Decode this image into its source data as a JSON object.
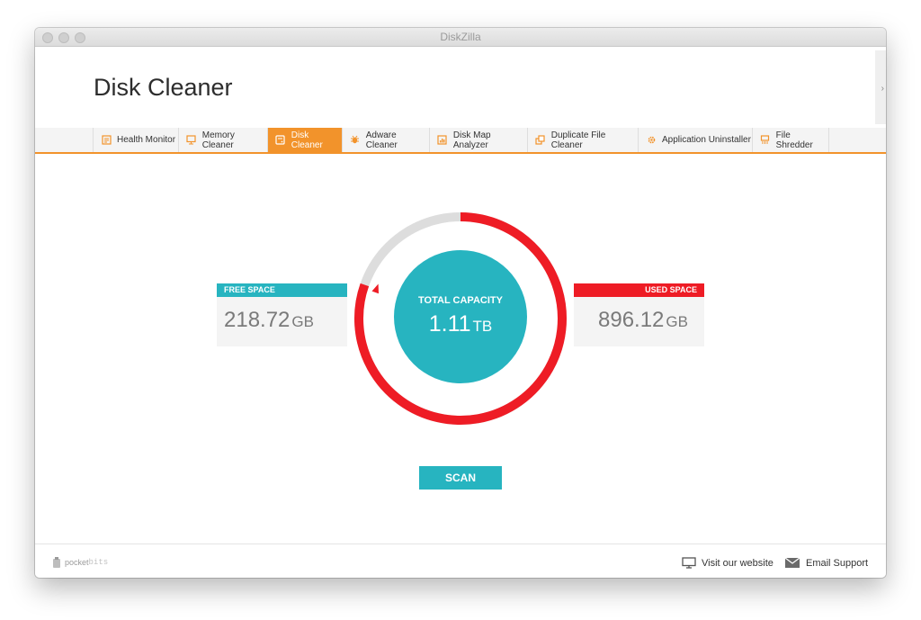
{
  "window": {
    "title": "DiskZilla"
  },
  "header": {
    "title": "Disk Cleaner"
  },
  "tabs": [
    {
      "label": "Health Monitor",
      "icon": "health-monitor-icon",
      "active": false
    },
    {
      "label": "Memory Cleaner",
      "icon": "monitor-icon",
      "active": false
    },
    {
      "label": "Disk Cleaner",
      "icon": "disk-icon",
      "active": true
    },
    {
      "label": "Adware Cleaner",
      "icon": "bug-icon",
      "active": false
    },
    {
      "label": "Disk Map Analyzer",
      "icon": "chart-icon",
      "active": false
    },
    {
      "label": "Duplicate File Cleaner",
      "icon": "duplicate-icon",
      "active": false
    },
    {
      "label": "Application Uninstaller",
      "icon": "gear-icon",
      "active": false
    },
    {
      "label": "File Shredder",
      "icon": "shredder-icon",
      "active": false
    }
  ],
  "free_space": {
    "label": "FREE SPACE",
    "value": "218.72",
    "unit": "GB",
    "color": "#27b4c0"
  },
  "used_space": {
    "label": "USED SPACE",
    "value": "896.12",
    "unit": "GB",
    "color": "#ee1c25"
  },
  "total_capacity": {
    "label": "TOTAL CAPACITY",
    "value": "1.11",
    "unit": "TB",
    "color": "#27b4c0"
  },
  "gauge": {
    "used_fraction": 0.8038,
    "track_color": "#dddddd"
  },
  "actions": {
    "scan_label": "SCAN"
  },
  "footer": {
    "brand_name": "pocket",
    "brand_bits": "bits",
    "website_label": "Visit our website",
    "support_label": "Email Support"
  },
  "colors": {
    "accent": "#f2932b",
    "teal": "#27b4c0",
    "red": "#ee1c25"
  }
}
